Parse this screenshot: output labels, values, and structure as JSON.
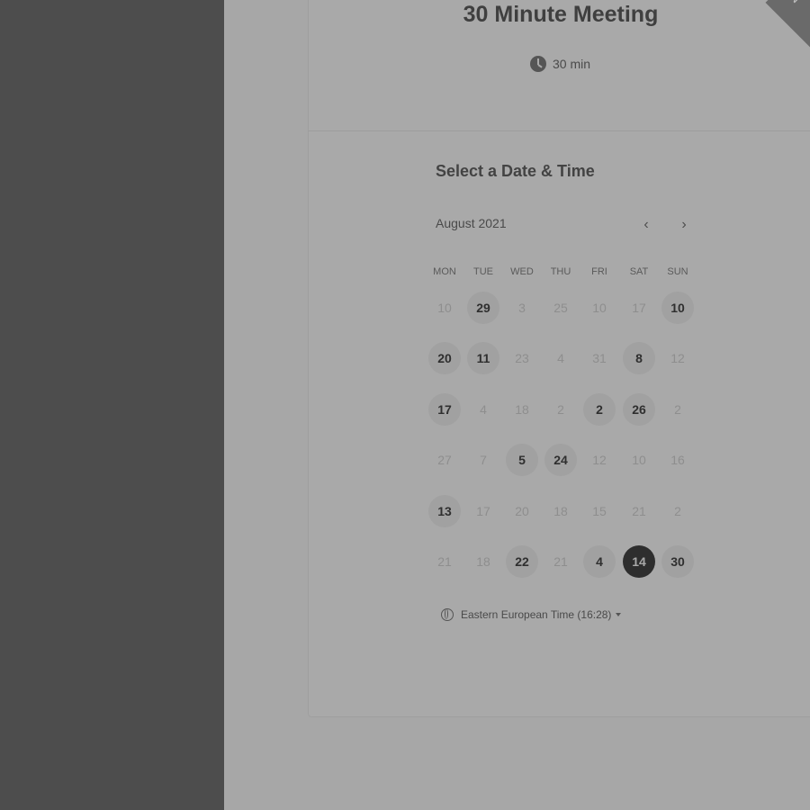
{
  "event": {
    "title": "30 Minute Meeting",
    "duration": "30 min",
    "ribbon": "N"
  },
  "calendar": {
    "section_title": "Select a Date & Time",
    "month_label": "August 2021",
    "prev_icon": "‹",
    "next_icon": "›",
    "weekdays": [
      "MON",
      "TUE",
      "WED",
      "THU",
      "FRI",
      "SAT",
      "SUN"
    ],
    "days": [
      [
        {
          "d": "10",
          "s": "n"
        },
        {
          "d": "29",
          "s": "a"
        },
        {
          "d": "3",
          "s": "n"
        },
        {
          "d": "25",
          "s": "n"
        },
        {
          "d": "10",
          "s": "n"
        },
        {
          "d": "17",
          "s": "n"
        },
        {
          "d": "10",
          "s": "a"
        }
      ],
      [
        {
          "d": "20",
          "s": "a"
        },
        {
          "d": "11",
          "s": "a"
        },
        {
          "d": "23",
          "s": "n"
        },
        {
          "d": "4",
          "s": "n"
        },
        {
          "d": "31",
          "s": "n"
        },
        {
          "d": "8",
          "s": "a"
        },
        {
          "d": "12",
          "s": "n"
        }
      ],
      [
        {
          "d": "17",
          "s": "a"
        },
        {
          "d": "4",
          "s": "n"
        },
        {
          "d": "18",
          "s": "n"
        },
        {
          "d": "2",
          "s": "n"
        },
        {
          "d": "2",
          "s": "a"
        },
        {
          "d": "26",
          "s": "a"
        },
        {
          "d": "2",
          "s": "n"
        }
      ],
      [
        {
          "d": "27",
          "s": "n"
        },
        {
          "d": "7",
          "s": "n"
        },
        {
          "d": "5",
          "s": "a"
        },
        {
          "d": "24",
          "s": "a"
        },
        {
          "d": "12",
          "s": "n"
        },
        {
          "d": "10",
          "s": "n"
        },
        {
          "d": "16",
          "s": "n"
        }
      ],
      [
        {
          "d": "13",
          "s": "a"
        },
        {
          "d": "17",
          "s": "n"
        },
        {
          "d": "20",
          "s": "n"
        },
        {
          "d": "18",
          "s": "n"
        },
        {
          "d": "15",
          "s": "n"
        },
        {
          "d": "21",
          "s": "n"
        },
        {
          "d": "2",
          "s": "n"
        }
      ],
      [
        {
          "d": "21",
          "s": "n"
        },
        {
          "d": "18",
          "s": "n"
        },
        {
          "d": "22",
          "s": "a"
        },
        {
          "d": "21",
          "s": "n"
        },
        {
          "d": "4",
          "s": "a"
        },
        {
          "d": "14",
          "s": "sel"
        },
        {
          "d": "30",
          "s": "a"
        }
      ]
    ],
    "timezone": "Eastern European Time (16:28)"
  },
  "icons": {
    "clock": "clock-icon",
    "globe": "globe-icon",
    "caret": "caret-down-icon"
  }
}
